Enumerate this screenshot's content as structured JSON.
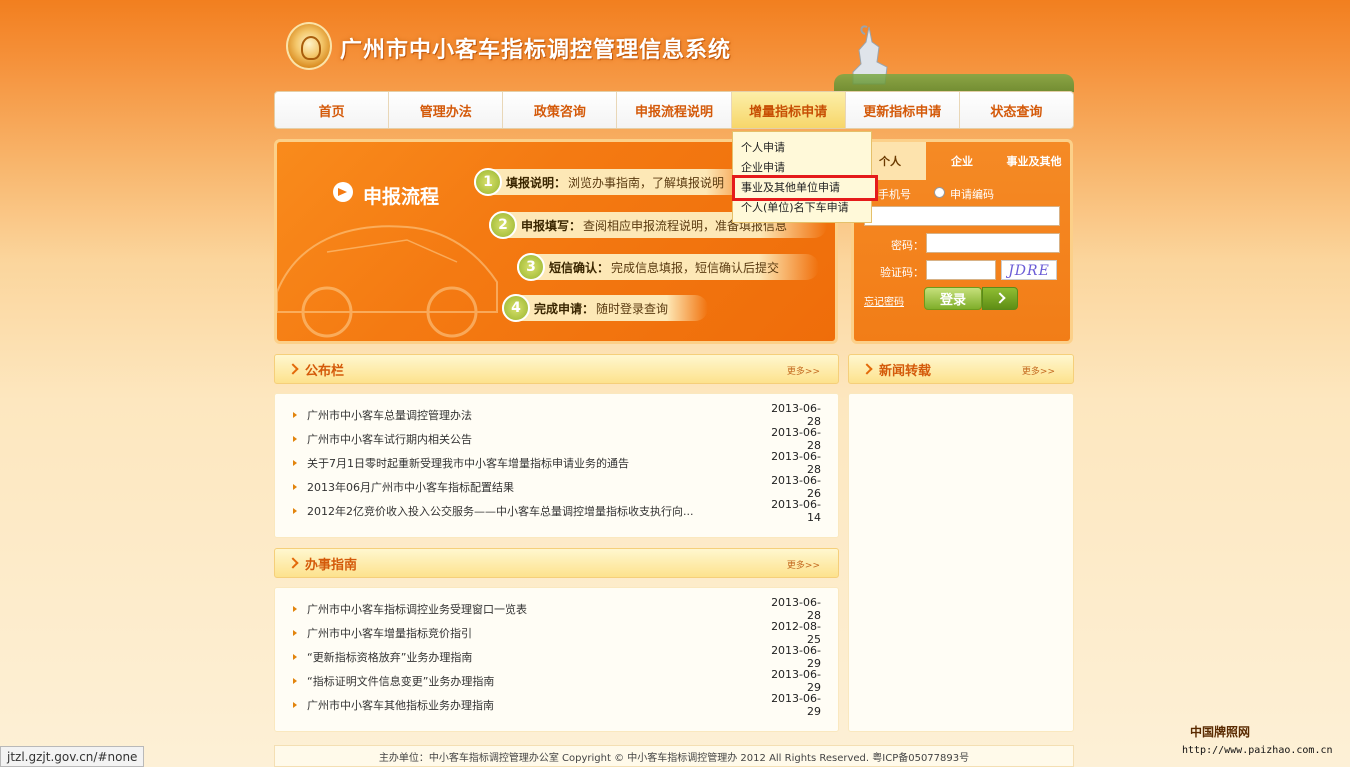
{
  "header": {
    "site_title": "广州市中小客车指标调控管理信息系统"
  },
  "nav": {
    "items": [
      "首页",
      "管理办法",
      "政策咨询",
      "申报流程说明",
      "增量指标申请",
      "更新指标申请",
      "状态查询"
    ]
  },
  "dropdown": {
    "items": [
      "个人申请",
      "企业申请",
      "事业及其他单位申请",
      "个人(单位)名下车申请"
    ],
    "highlighted_index": 2
  },
  "banner": {
    "title": "申报流程",
    "steps": [
      {
        "num": "1",
        "label": "填报说明：",
        "text": "浏览办事指南，了解填报说明"
      },
      {
        "num": "2",
        "label": "申报填写：",
        "text": "查阅相应申报流程说明，准备填报信息"
      },
      {
        "num": "3",
        "label": "短信确认：",
        "text": "完成信息填报，短信确认后提交"
      },
      {
        "num": "4",
        "label": "完成申请：",
        "text": "随时登录查询"
      }
    ]
  },
  "login": {
    "tabs": [
      "个人",
      "企业",
      "事业及其他"
    ],
    "radio1": "手机号",
    "radio2": "申请编码",
    "password_label": "密码：",
    "captcha_label": "验证码：",
    "captcha_text": "JDRE",
    "forgot": "忘记密码",
    "login_button": "登录"
  },
  "announcements": {
    "title": "公布栏",
    "more": "更多>>",
    "rows": [
      {
        "text": "广州市中小客车总量调控管理办法",
        "date": "2013-06-28"
      },
      {
        "text": "广州市中小客车试行期内相关公告",
        "date": "2013-06-28"
      },
      {
        "text": "关于7月1日零时起重新受理我市中小客车增量指标申请业务的通告",
        "date": "2013-06-28"
      },
      {
        "text": "2013年06月广州市中小客车指标配置结果",
        "date": "2013-06-26"
      },
      {
        "text": "2012年2亿竞价收入投入公交服务——中小客车总量调控增量指标收支执行向...",
        "date": "2013-06-14"
      }
    ]
  },
  "guide": {
    "title": "办事指南",
    "more": "更多>>",
    "rows": [
      {
        "text": "广州市中小客车指标调控业务受理窗口一览表",
        "date": "2013-06-28"
      },
      {
        "text": "广州市中小客车增量指标竞价指引",
        "date": "2012-08-25"
      },
      {
        "text": "“更新指标资格放弃”业务办理指南",
        "date": "2013-06-29"
      },
      {
        "text": "“指标证明文件信息变更”业务办理指南",
        "date": "2013-06-29"
      },
      {
        "text": "广州市中小客车其他指标业务办理指南",
        "date": "2013-06-29"
      }
    ]
  },
  "news": {
    "title": "新闻转载",
    "more": "更多>>"
  },
  "footer": {
    "text": "主办单位：中小客车指标调控管理办公室  Copyright ©  中小客车指标调控管理办   2012  All Rights Reserved.  粤ICP备05077893号"
  },
  "statusbar": {
    "url": "jtzl.gzjt.gov.cn/#none"
  },
  "watermark": {
    "name": "中国牌照网",
    "url": "http://www.paizhao.com.cn"
  }
}
